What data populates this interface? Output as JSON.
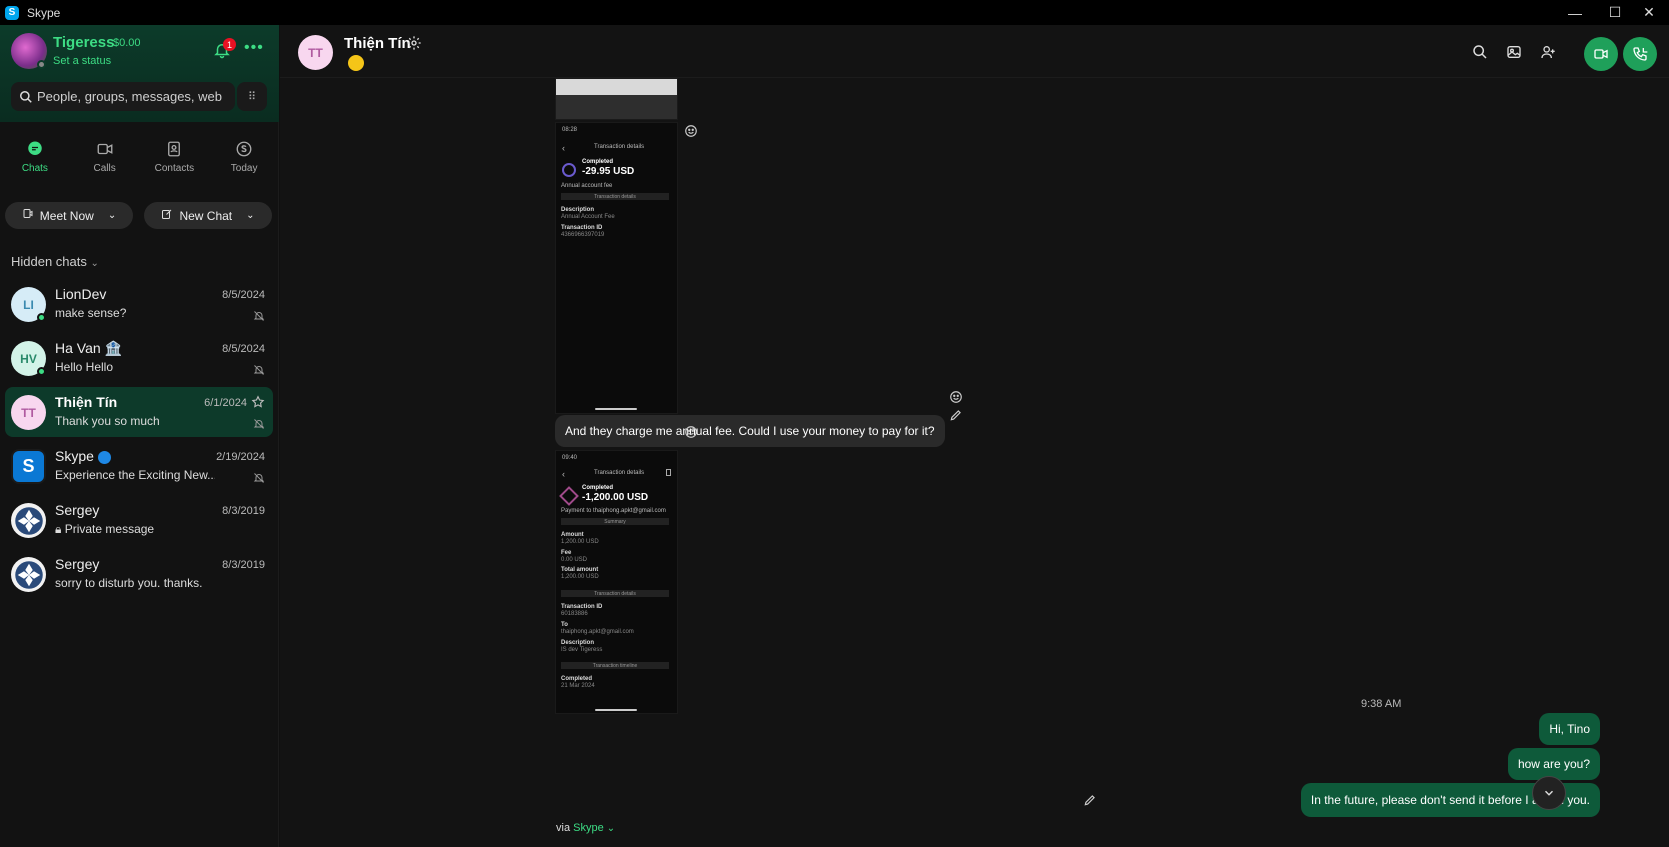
{
  "window": {
    "title": "Skype"
  },
  "profile": {
    "name": "Tigeress",
    "balance": "$0.00",
    "status": "Set a status",
    "notification_count": "1"
  },
  "search": {
    "placeholder": "People, groups, messages, web"
  },
  "nav": {
    "chats": "Chats",
    "calls": "Calls",
    "contacts": "Contacts",
    "today": "Today"
  },
  "actions": {
    "meet_now": "Meet Now",
    "new_chat": "New Chat"
  },
  "hidden_chats": "Hidden chats",
  "chats": [
    {
      "initials": "LI",
      "name": "LionDev",
      "date": "8/5/2024",
      "preview": "make sense?"
    },
    {
      "initials": "HV",
      "name": "Ha Van 🏦",
      "date": "8/5/2024",
      "preview": "Hello Hello"
    },
    {
      "initials": "TT",
      "name": "Thiện Tín",
      "date": "6/1/2024",
      "preview": "Thank you so much"
    },
    {
      "initials": "S",
      "name": "Skype",
      "date": "2/19/2024",
      "preview": "Experience the Exciting New..."
    },
    {
      "initials": "",
      "name": "Sergey",
      "date": "8/3/2019",
      "preview": "Private message"
    },
    {
      "initials": "",
      "name": "Sergey",
      "date": "8/3/2019",
      "preview": "sorry to disturb you. thanks."
    }
  ],
  "conversation": {
    "contact_initials": "TT",
    "contact_name": "Thiện Tín",
    "shot1": {
      "time": "08:28",
      "title": "Transaction details",
      "status": "Completed",
      "amount": "-29.95 USD",
      "label": "Annual account fee",
      "section": "Transaction details",
      "desc_label": "Description",
      "desc_value": "Annual Account Fee",
      "id_label": "Transaction ID",
      "id_value": "4366966397019"
    },
    "message_in": "And they charge me annual fee. Could I use your money to pay for it?",
    "shot2": {
      "time": "09:40",
      "title": "Transaction details",
      "status": "Completed",
      "amount": "-1,200.00 USD",
      "label": "Payment to thaiphong.apkt@gmail.com",
      "summary": "Summary",
      "amount_label": "Amount",
      "amount_value": "1,200.00 USD",
      "fee_label": "Fee",
      "fee_value": "0.00 USD",
      "total_label": "Total amount",
      "total_value": "1,200.00 USD",
      "section": "Transaction details",
      "id_label": "Transaction ID",
      "id_value": "60183886",
      "to_label": "To",
      "to_value": "thaiphong.apkt@gmail.com",
      "desc_label": "Description",
      "desc_value": "IS dev Tigeress",
      "timeline": "Transaction timeline",
      "completed_label": "Completed",
      "completed_date": "21 Mar 2024"
    },
    "time_label": "9:38 AM",
    "messages_out": [
      "Hi, Tino",
      "how are you?",
      "In the future, please don't send it before I asked you."
    ],
    "via": "via",
    "via_app": "Skype"
  },
  "colors": {
    "accent": "#3ddc84",
    "bubble_out": "#0e5a3a",
    "bubble_in": "#2a2a2a"
  }
}
